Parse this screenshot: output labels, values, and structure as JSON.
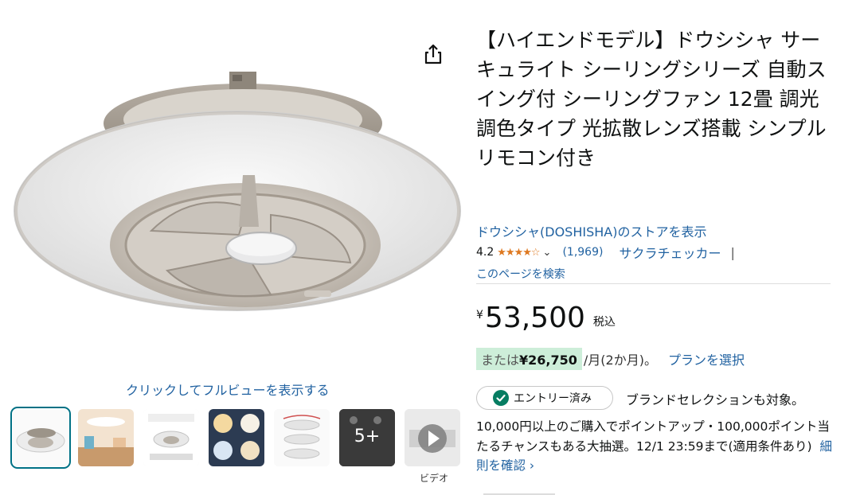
{
  "product": {
    "title": "【ハイエンドモデル】ドウシシャ サーキュライト シーリングシリーズ 自動スイング付 シーリングファン 12畳 調光調色タイプ 光拡散レンズ搭載 シンプルリモコン付き",
    "store_link": "ドウシシャ(DOSHISHA)のストアを表示",
    "rating": "4.2",
    "rating_count": "(1,969)",
    "sakura_checker": "サクラチェッカー",
    "separator": "|",
    "search_page": "このページを検索"
  },
  "gallery": {
    "fullview_link": "クリックしてフルビューを表示する",
    "more_count": "5+",
    "video_label": "ビデオ"
  },
  "price": {
    "currency": "¥",
    "amount": "53,500",
    "tax_label": "税込",
    "installment_prefix": "または",
    "installment_amount": "¥26,750",
    "installment_suffix": "/月(2か月)。",
    "plan_link": "プランを選択"
  },
  "promo": {
    "entry_badge": "エントリー済み",
    "brand_selection": "ブランドセレクションも対象。",
    "campaign_text": "10,000円以上のご購入でポイントアップ・100,000ポイント当たるチャンスもある大抽選。12/1 23:59まで(適用条件あり)",
    "details_link": "細則を確認 ›"
  },
  "colors": {
    "link": "#2162a1",
    "star": "#de7921",
    "installment_bg": "#cdeed9",
    "check": "#067d62",
    "selected_thumb": "#007185"
  }
}
